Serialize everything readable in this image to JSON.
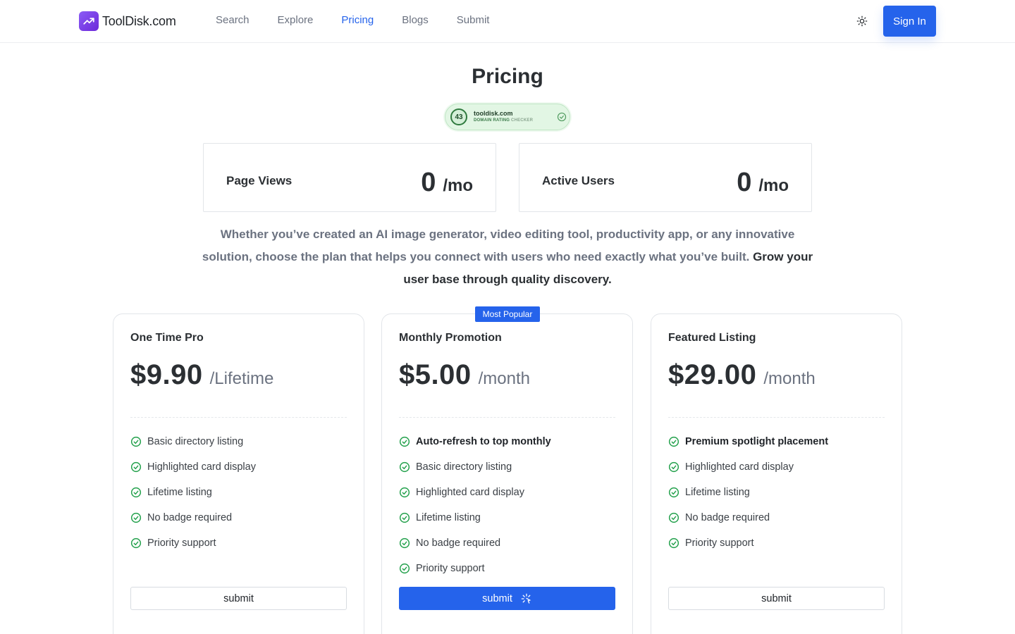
{
  "header": {
    "logo_text": "ToolDisk.com",
    "nav": [
      {
        "label": "Search",
        "active": false
      },
      {
        "label": "Explore",
        "active": false
      },
      {
        "label": "Pricing",
        "active": true
      },
      {
        "label": "Blogs",
        "active": false
      },
      {
        "label": "Submit",
        "active": false
      }
    ],
    "theme_icon": "sun-icon",
    "signin_label": "Sign In"
  },
  "page_title": "Pricing",
  "domain_badge": {
    "score": "43",
    "domain": "tooldisk.com",
    "subtitle_main": "DOMAIN RATING ",
    "subtitle_highlight": "CHECKER"
  },
  "stats": [
    {
      "label": "Page Views",
      "value": "0",
      "unit": "/mo"
    },
    {
      "label": "Active Users",
      "value": "0",
      "unit": "/mo"
    }
  ],
  "description": {
    "text": "Whether you’ve created an AI image generator, video editing tool, productivity app, or any innovative solution, choose the plan that helps you connect with users who need exactly what you’ve built. ",
    "emphasis": "Grow your user base through quality discovery."
  },
  "popular_label": "Most Popular",
  "plans": [
    {
      "name": "One Time Pro",
      "price": "$9.90",
      "period": "/Lifetime",
      "features": [
        {
          "text": "Basic directory listing",
          "bold": false
        },
        {
          "text": "Highlighted card display",
          "bold": false
        },
        {
          "text": "Lifetime listing",
          "bold": false
        },
        {
          "text": "No badge required",
          "bold": false
        },
        {
          "text": "Priority support",
          "bold": false
        }
      ],
      "button": "submit",
      "primary": false
    },
    {
      "name": "Monthly Promotion",
      "price": "$5.00",
      "period": "/month",
      "features": [
        {
          "text": "Auto-refresh to top monthly",
          "bold": true
        },
        {
          "text": "Basic directory listing",
          "bold": false
        },
        {
          "text": "Highlighted card display",
          "bold": false
        },
        {
          "text": "Lifetime listing",
          "bold": false
        },
        {
          "text": "No badge required",
          "bold": false
        },
        {
          "text": "Priority support",
          "bold": false
        }
      ],
      "button": "submit",
      "primary": true
    },
    {
      "name": "Featured Listing",
      "price": "$29.00",
      "period": "/month",
      "features": [
        {
          "text": "Premium spotlight placement",
          "bold": true
        },
        {
          "text": "Highlighted card display",
          "bold": false
        },
        {
          "text": "Lifetime listing",
          "bold": false
        },
        {
          "text": "No badge required",
          "bold": false
        },
        {
          "text": "Priority support",
          "bold": false
        }
      ],
      "button": "submit",
      "primary": false
    }
  ],
  "colors": {
    "accent": "#2563eb",
    "logo": "#7c3aed",
    "check": "#22a04b",
    "badge_bg": "#e2f6e4"
  }
}
